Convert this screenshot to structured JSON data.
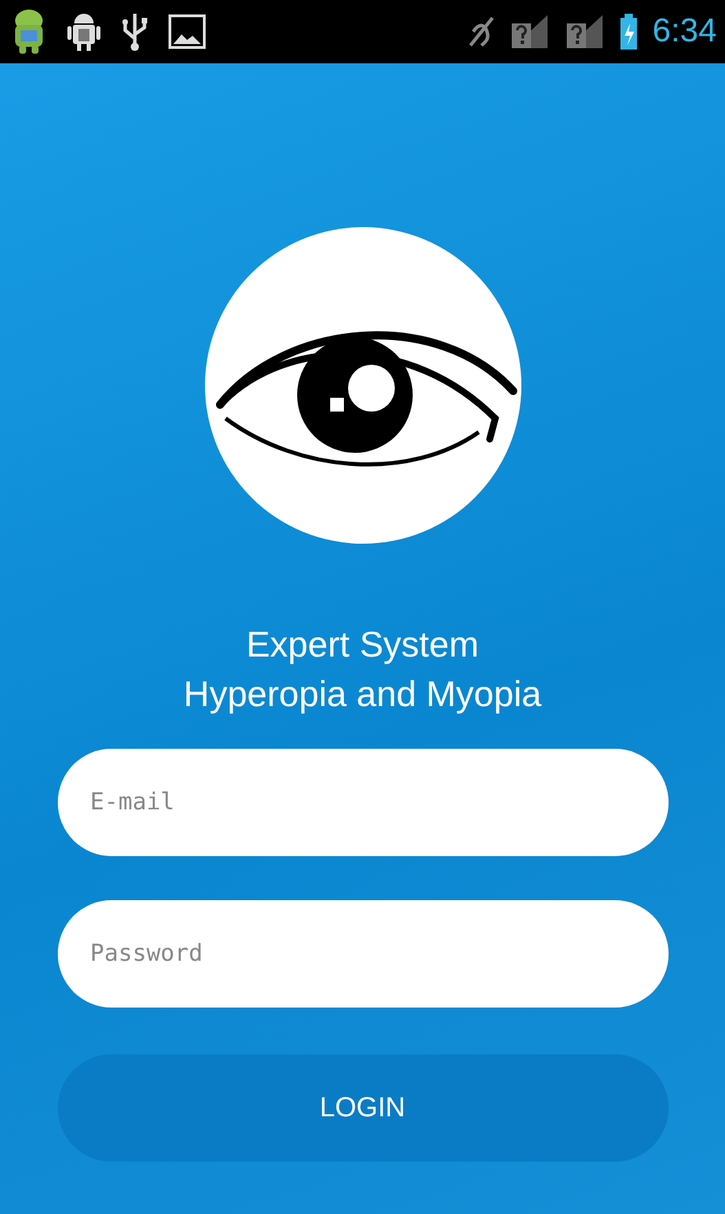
{
  "status_bar": {
    "time": "6:34"
  },
  "app_title": [
    "Expert System",
    "Hyperopia and Myopia"
  ],
  "email_field": {
    "placeholder": "E-mail"
  },
  "password_field": {
    "placeholder": "Password"
  },
  "login_button": {
    "label": "LOGIN"
  }
}
